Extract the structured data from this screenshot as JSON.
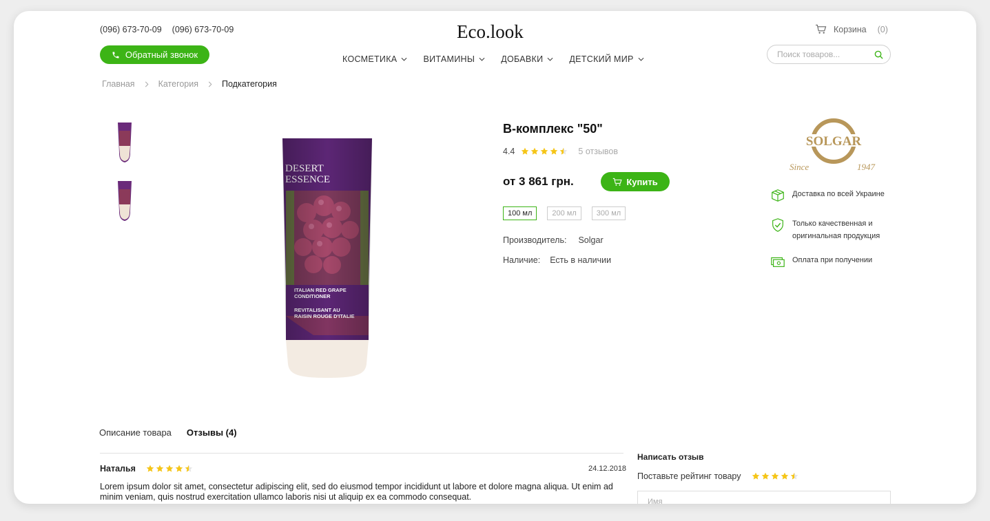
{
  "header": {
    "phones": [
      "(096) 673-70-09",
      "(096) 673-70-09"
    ],
    "callback_label": "Обратный звонок",
    "logo": "Eco.look",
    "cart_label": "Корзина",
    "cart_count": "(0)",
    "search_placeholder": "Поиск товаров...",
    "nav": [
      "КОСМЕТИКА",
      "ВИТАМИНЫ",
      "ДОБАВКИ",
      "ДЕТСКИЙ МИР"
    ]
  },
  "breadcrumb": [
    "Главная",
    "Категория",
    "Подкатегория"
  ],
  "product": {
    "title": "B-комплекс \"50\"",
    "rating": "4.4",
    "rating_value": 4.5,
    "reviews_count_label": "5 отзывов",
    "price": "от 3 861  грн.",
    "buy_label": "Купить",
    "volumes": [
      "100 мл",
      "200 мл",
      "300 мл"
    ],
    "selected_volume": "100 мл",
    "manufacturer_label": "Производитель:",
    "manufacturer_value": "Solgar",
    "availability_label": "Наличие:",
    "availability_value": "Есть в наличии",
    "image_brand_text": "DESERT ESSENCE",
    "image_product_text": "ITALIAN RED GRAPE CONDITIONER",
    "image_product_text_fr": "REVITALISANT AU RAISIN ROUGE D'ITALIE"
  },
  "brand": {
    "name": "SOLGAR",
    "since": "Since",
    "year": "1947"
  },
  "features": [
    {
      "icon": "box-icon",
      "text": "Доставка по всей Украине"
    },
    {
      "icon": "shield-check-icon",
      "text": "Только качественная и оригинальная продукция"
    },
    {
      "icon": "cash-icon",
      "text": "Оплата при получении"
    }
  ],
  "tabs": [
    "Описание товара",
    "Отзывы (4)"
  ],
  "active_tab": "Отзывы (4)",
  "review": {
    "author": "Наталья",
    "date": "24.12.2018",
    "rating_value": 4.5,
    "text": "Lorem ipsum dolor sit amet, consectetur adipiscing elit, sed do eiusmod tempor incididunt ut labore et dolore magna aliqua. Ut enim ad minim veniam, quis nostrud exercitation ullamco laboris nisi ut aliquip ex ea commodo consequat."
  },
  "write_review": {
    "title": "Написать отзыв",
    "rate_label": "Поставьте рейтинг товару",
    "rating_value": 4.5,
    "name_placeholder": "Имя"
  },
  "colors": {
    "accent": "#3cb416",
    "star": "#f5c518",
    "brand_gold": "#b8975a"
  }
}
